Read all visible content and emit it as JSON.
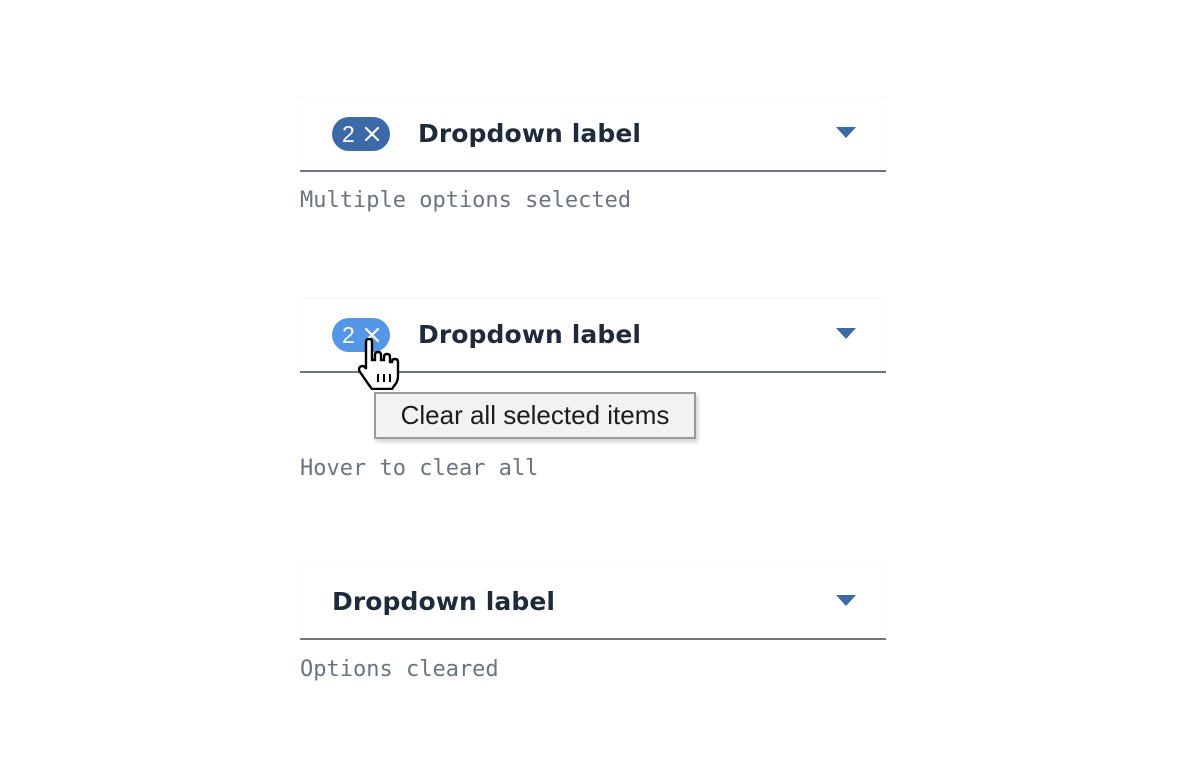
{
  "accent_colors": {
    "tag_default": "#3b6aa6",
    "tag_hover": "#5596e6",
    "caret": "#3b6aa6",
    "text": "#1f2a3a",
    "helper_text": "#6b7480"
  },
  "examples": [
    {
      "tag_count": "2",
      "tag_icon": "close-icon",
      "label": "Dropdown label",
      "caret_icon": "caret-down-icon",
      "helper": "Multiple options selected"
    },
    {
      "tag_count": "2",
      "tag_icon": "close-icon",
      "label": "Dropdown label",
      "caret_icon": "caret-down-icon",
      "tooltip": "Clear all selected items",
      "cursor_icon": "hand-pointer-icon",
      "helper": "Hover to clear all"
    },
    {
      "label": "Dropdown label",
      "caret_icon": "caret-down-icon",
      "helper": "Options cleared"
    }
  ]
}
